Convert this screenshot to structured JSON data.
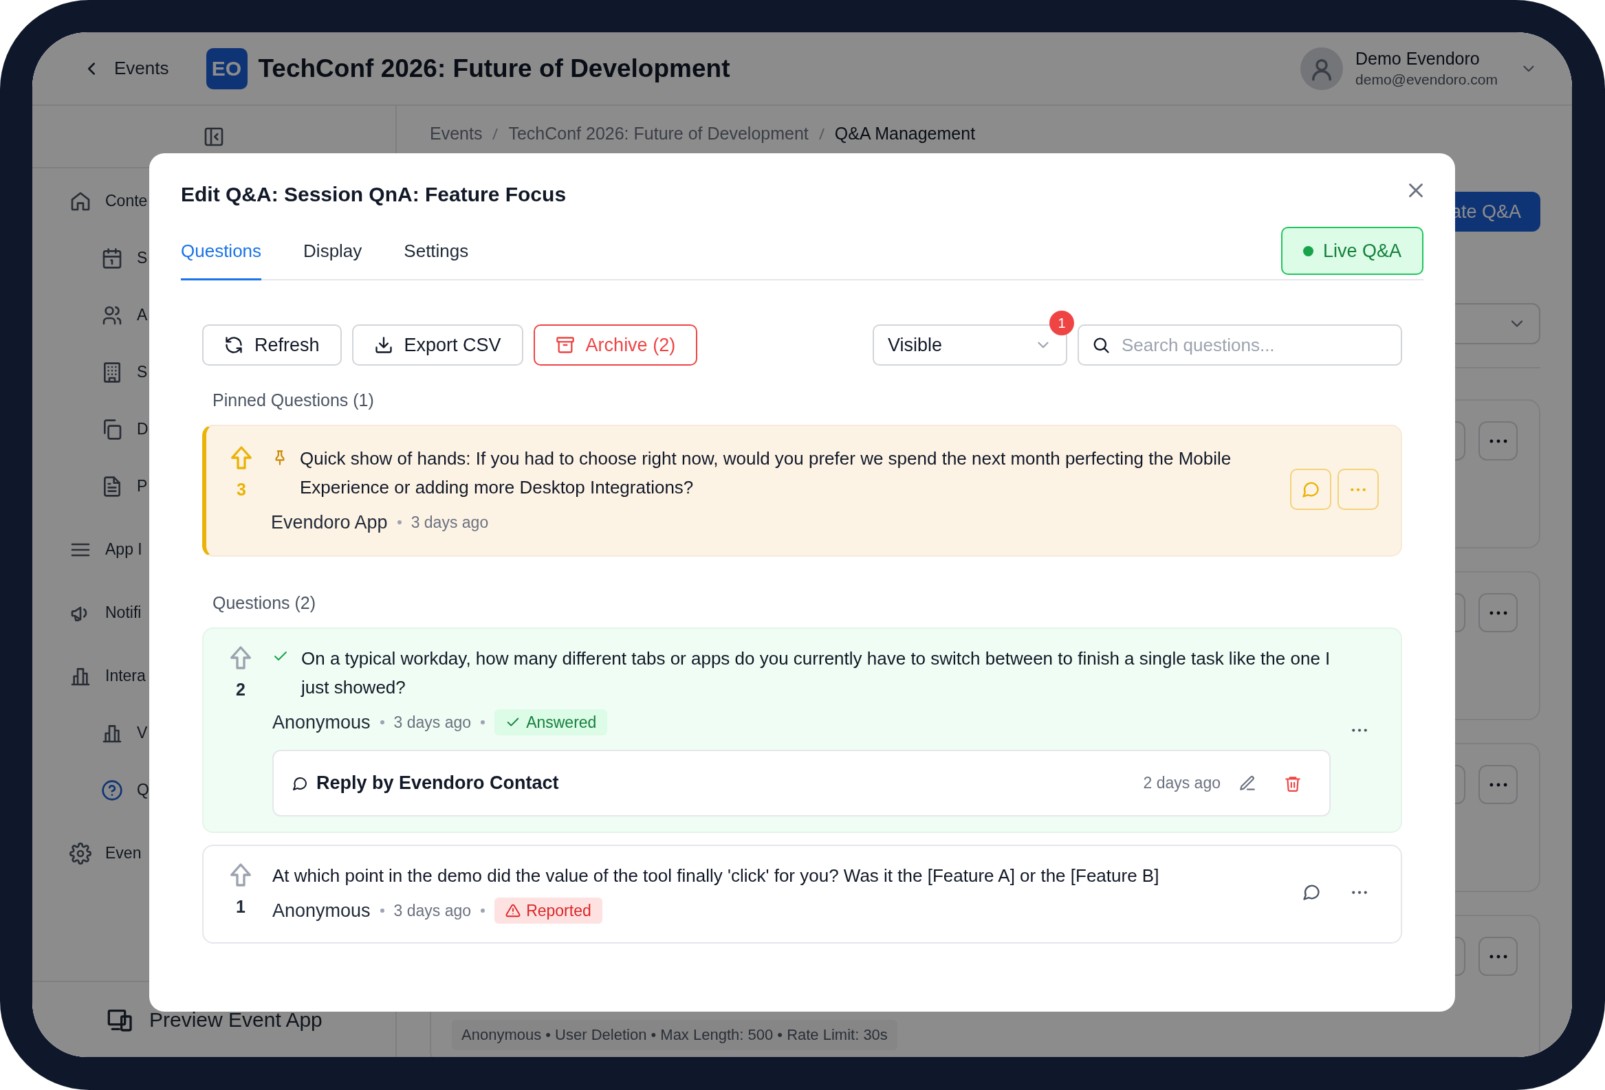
{
  "app_header": {
    "back_label": "Events",
    "logo": "EO",
    "title": "TechConf 2026: Future of Development",
    "user_name": "Demo Evendoro",
    "user_email": "demo@evendoro.com"
  },
  "sidebar": {
    "items": [
      {
        "label": "Conte",
        "selected": false,
        "children": [
          {
            "label": "S",
            "selected": false
          },
          {
            "label": "A",
            "selected": false
          },
          {
            "label": "S",
            "selected": false
          },
          {
            "label": "D",
            "selected": false
          },
          {
            "label": "P",
            "selected": false
          }
        ]
      },
      {
        "label": "App I",
        "selected": false
      },
      {
        "label": "Notifi",
        "selected": false
      },
      {
        "label": "Intera",
        "selected": false,
        "children": [
          {
            "label": "V",
            "selected": false
          },
          {
            "label": "Q",
            "selected": true
          }
        ]
      },
      {
        "label": "Even",
        "selected": false
      }
    ],
    "footer": "Preview Event App"
  },
  "main": {
    "breadcrumb": [
      "Events",
      "TechConf 2026: Future of Development",
      "Q&A Management"
    ],
    "create_button": "ate Q&A",
    "footer_info": "Anonymous • User Deletion • Max Length: 500 • Rate Limit: 30s"
  },
  "modal": {
    "title": "Edit Q&A: Session QnA: Feature Focus",
    "tabs": [
      {
        "label": "Questions",
        "selected": true
      },
      {
        "label": "Display",
        "selected": false
      },
      {
        "label": "Settings",
        "selected": false
      }
    ],
    "live_button": {
      "label": "Live Q&A",
      "on": true
    },
    "toolbar": {
      "buttons": [
        {
          "label": "Refresh",
          "kind": "refresh"
        },
        {
          "label": "Export CSV",
          "kind": "export"
        },
        {
          "label": "Archive (2)",
          "kind": "archive"
        }
      ],
      "filter": {
        "value": "Visible",
        "badge": "1"
      },
      "search": {
        "placeholder": "Search questions..."
      }
    },
    "sections": [
      {
        "title": "Pinned Questions (1)",
        "questions": [
          {
            "votes": "3",
            "text": "Quick show of hands: If you had to choose right now, would you prefer we spend the next month perfecting the Mobile Experience or adding more Desktop Integrations?",
            "author": "Evendoro App",
            "time": "3 days ago",
            "pinned": true,
            "answered": false
          }
        ]
      },
      {
        "title": "Questions (2)",
        "questions": [
          {
            "votes": "2",
            "text": "On a typical workday, how many different tabs or apps do you currently have to switch between to finish a single task like the one I just showed?",
            "author": "Anonymous",
            "time": "3 days ago",
            "pinned": false,
            "answered": true,
            "badge": {
              "label": "Answered",
              "kind": "answered"
            },
            "reply": {
              "title": "Reply by Evendoro Contact",
              "time": "2 days ago"
            }
          },
          {
            "votes": "1",
            "text": "At which point in the demo did the value of the tool finally 'click' for you? Was it the [Feature A] or the [Feature B]",
            "author": "Anonymous",
            "time": "3 days ago",
            "pinned": false,
            "answered": false,
            "badge": {
              "label": "Reported",
              "kind": "reported"
            }
          }
        ]
      }
    ]
  }
}
